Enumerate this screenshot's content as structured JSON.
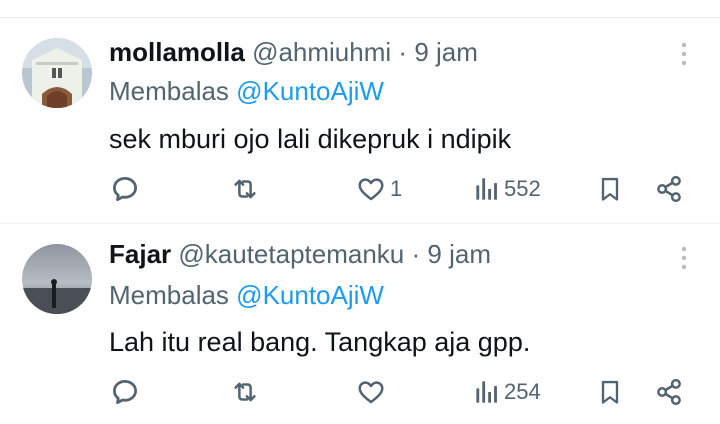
{
  "tweets": [
    {
      "display_name": "mollamolla",
      "handle": "@ahmiuhmi",
      "dot": "·",
      "time": "9 jam",
      "reply_prefix": "Membalas",
      "reply_to": "@KuntoAjiW",
      "text": "sek mburi ojo lali dikepruk i ndipik",
      "reply_count": "",
      "retweet_count": "",
      "like_count": "1",
      "view_count": "552"
    },
    {
      "display_name": "Fajar",
      "handle": "@kautetaptemanku",
      "dot": "·",
      "time": "9 jam",
      "reply_prefix": "Membalas",
      "reply_to": "@KuntoAjiW",
      "text": "Lah itu real bang. Tangkap aja gpp.",
      "reply_count": "",
      "retweet_count": "",
      "like_count": "",
      "view_count": "254"
    }
  ],
  "colors": {
    "text": "#0f1419",
    "secondary": "#536471",
    "mention": "#1d9bf0",
    "divider": "#eff3f4"
  },
  "icons": [
    "reply-icon",
    "retweet-icon",
    "like-icon",
    "views-icon",
    "bookmark-icon",
    "share-icon",
    "more-icon"
  ]
}
